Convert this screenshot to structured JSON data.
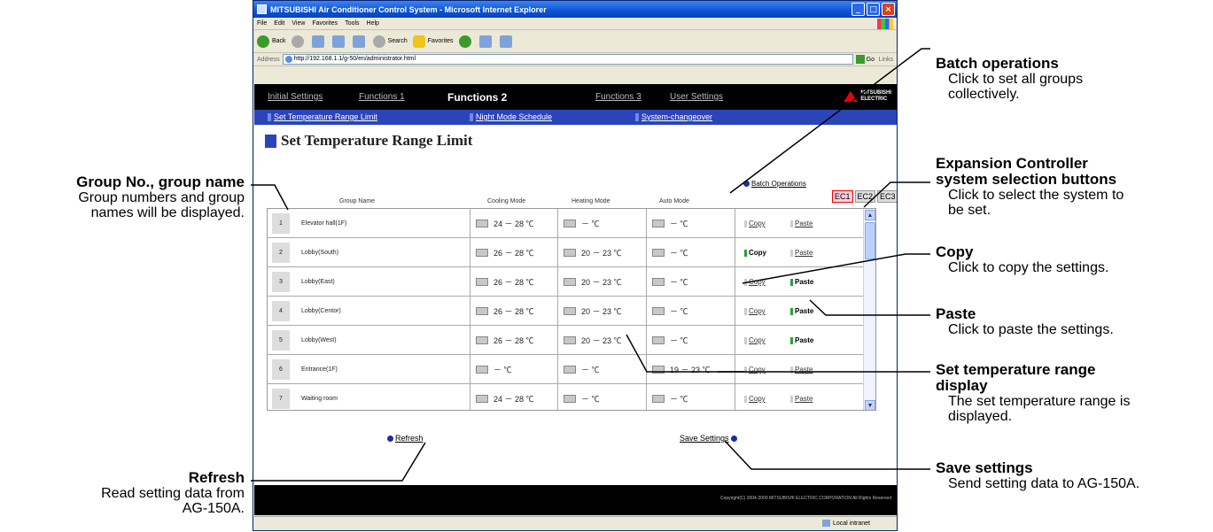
{
  "browser": {
    "title": "MITSUBISHI Air Conditioner Control System - Microsoft Internet Explorer",
    "menu": [
      "File",
      "Edit",
      "View",
      "Favorites",
      "Tools",
      "Help"
    ],
    "toolbar": [
      "Back",
      "Search",
      "Favorites"
    ],
    "address_label": "Address",
    "url": "http://192.168.1.1/g-50/en/administrator.html",
    "go": "Go",
    "links": "Links",
    "status_zone": "Local intranet"
  },
  "nav": {
    "tabs": [
      "Initial Settings",
      "Functions 1",
      "Functions 2",
      "Functions 3",
      "User Settings"
    ],
    "active": "Functions 2",
    "subtabs": [
      "Set Temperature Range Limit",
      "Night Mode Schedule",
      "System-changeover"
    ],
    "logo": [
      "MITSUBISHI",
      "ELECTRIC"
    ]
  },
  "page": {
    "title": "Set Temperature Range Limit",
    "batch": "Batch Operations",
    "ec_buttons": [
      "EC1",
      "EC2",
      "EC3"
    ],
    "columns": [
      "Group Name",
      "Cooling Mode",
      "Heating Mode",
      "Auto Mode"
    ],
    "refresh": "Refresh",
    "save": "Save Settings",
    "copyright": "Copyright(C) 2004-2009 MITSUBISHI ELECTRIC CORPORATION All Rights Reserved"
  },
  "rows": [
    {
      "no": "1",
      "name": "Elevator hall(1F)",
      "cool": "24 － 28 ℃",
      "heat": "－ ℃",
      "auto": "－ ℃",
      "copy": "Copy",
      "paste": "Paste"
    },
    {
      "no": "2",
      "name": "Lobby(South)",
      "cool": "26 － 28 ℃",
      "heat": "20 － 23 ℃",
      "auto": "－ ℃",
      "copy": "Copy",
      "paste": "Paste"
    },
    {
      "no": "3",
      "name": "Lobby(East)",
      "cool": "26 － 28 ℃",
      "heat": "20 － 23 ℃",
      "auto": "－ ℃",
      "copy": "Copy",
      "paste": "Paste"
    },
    {
      "no": "4",
      "name": "Lobby(Centor)",
      "cool": "26 － 28 ℃",
      "heat": "20 － 23 ℃",
      "auto": "－ ℃",
      "copy": "Copy",
      "paste": "Paste"
    },
    {
      "no": "5",
      "name": "Lobby(West)",
      "cool": "26 － 28 ℃",
      "heat": "20 － 23 ℃",
      "auto": "－ ℃",
      "copy": "Copy",
      "paste": "Paste"
    },
    {
      "no": "6",
      "name": "Entrance(1F)",
      "cool": "－ ℃",
      "heat": "－ ℃",
      "auto": "19 － 23 ℃",
      "copy": "Copy",
      "paste": "Paste"
    },
    {
      "no": "7",
      "name": "Waiting room",
      "cool": "24 － 28 ℃",
      "heat": "－ ℃",
      "auto": "－ ℃",
      "copy": "Copy",
      "paste": "Paste"
    }
  ],
  "annotations": {
    "batch": {
      "title": "Batch operations",
      "desc": [
        "Click to set all groups",
        "collectively."
      ]
    },
    "ec": {
      "title": [
        "Expansion Controller",
        "system selection buttons"
      ],
      "desc": [
        "Click to select the system to",
        "be set."
      ]
    },
    "copy": {
      "title": "Copy",
      "desc": [
        "Click to copy the settings."
      ]
    },
    "paste": {
      "title": "Paste",
      "desc": [
        "Click to paste the settings."
      ]
    },
    "range": {
      "title": [
        "Set temperature range",
        "display"
      ],
      "desc": [
        "The set temperature range is",
        "displayed."
      ]
    },
    "save": {
      "title": "Save settings",
      "desc": [
        "Send setting data to AG-150A."
      ]
    },
    "group": {
      "title": "Group No., group name",
      "desc": [
        "Group numbers and group",
        "names will be displayed."
      ]
    },
    "refresh": {
      "title": "Refresh",
      "desc": [
        "Read setting data from",
        "AG-150A."
      ]
    }
  }
}
